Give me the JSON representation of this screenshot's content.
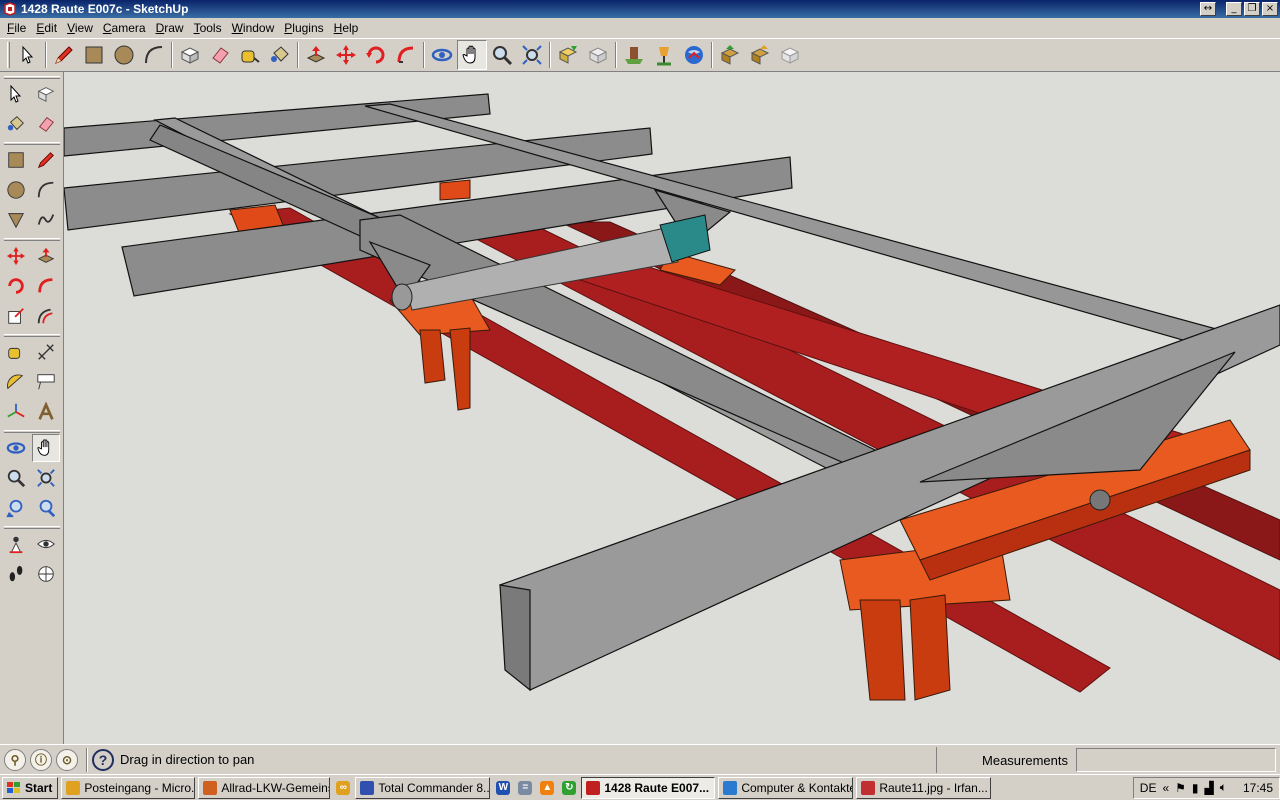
{
  "window": {
    "title": "1428 Raute E007c - SketchUp"
  },
  "menu": [
    {
      "key": "F",
      "rest": "ile"
    },
    {
      "key": "E",
      "rest": "dit"
    },
    {
      "key": "V",
      "rest": "iew"
    },
    {
      "key": "C",
      "rest": "amera"
    },
    {
      "key": "D",
      "rest": "raw"
    },
    {
      "key": "T",
      "rest": "ools"
    },
    {
      "key": "W",
      "rest": "indow"
    },
    {
      "key": "P",
      "rest": "lugins"
    },
    {
      "key": "H",
      "rest": "elp"
    }
  ],
  "toolbar": {
    "buttons": [
      "select-icon",
      "pencil-icon",
      "rectangle-icon",
      "circle-icon",
      "arc-icon",
      "make-component-icon",
      "eraser-icon",
      "tape-measure-icon",
      "paint-bucket-icon",
      "push-pull-icon",
      "move-icon",
      "rotate-icon",
      "follow-me-icon",
      "orbit-icon",
      "pan-icon",
      "zoom-icon",
      "zoom-extents-icon",
      "get-models-icon",
      "share-model-icon",
      "place-model-icon",
      "google-earth-icon",
      "photo-textures-icon",
      "get-components-icon",
      "share-component-icon",
      "warehouse-icon"
    ],
    "active": "pan-icon"
  },
  "left_toolbar": {
    "active": "pan-icon"
  },
  "status": {
    "hint": "Drag in direction to pan",
    "measurements_label": "Measurements",
    "measurements_value": ""
  },
  "taskbar": {
    "start": "Start",
    "tasks": [
      {
        "label": "Posteingang - Micro...",
        "color": "#e0a020"
      },
      {
        "label": "Allrad-LKW-Gemeins...",
        "color": "#d06020"
      },
      {
        "label": "Total Commander 8....",
        "color": "#3050b0"
      },
      {
        "label": "1428 Raute E007...",
        "color": "#c02020",
        "active": true
      },
      {
        "label": "Computer & Kontakte",
        "color": "#2a7ad0"
      },
      {
        "label": "Raute11.jpg - Irfan...",
        "color": "#c03030"
      }
    ],
    "lang": "DE",
    "clock": "17:45"
  }
}
